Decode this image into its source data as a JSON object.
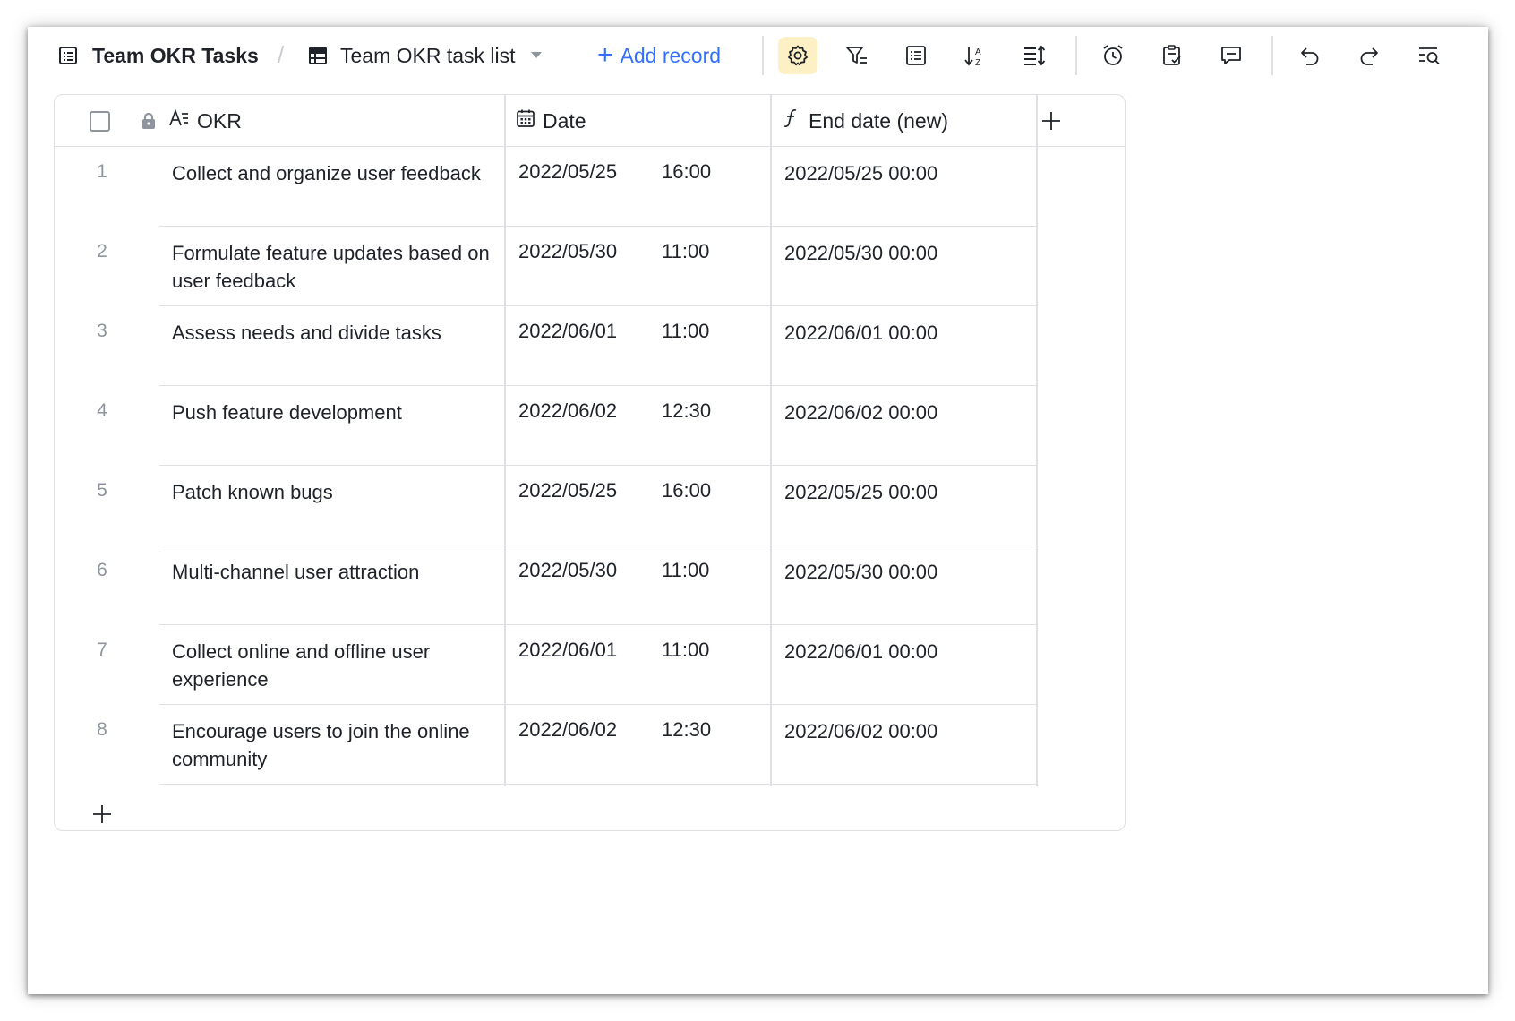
{
  "toolbar": {
    "base_name": "Team OKR Tasks",
    "separator": "/",
    "table_name": "Team OKR task list",
    "add_record_label": "Add record",
    "add_record_plus": "+",
    "icons": [
      "settings-icon",
      "filter-icon",
      "group-icon",
      "sort-icon",
      "row-height-icon",
      "reminder-icon",
      "task-check-icon",
      "comment-icon",
      "undo-icon",
      "redo-icon",
      "search-icon"
    ],
    "accent_color": "#3370ff",
    "active_icon_bg": "#fdf0c4"
  },
  "grid": {
    "columns": [
      {
        "key": "okr",
        "label": "OKR",
        "icon": "text-field-icon"
      },
      {
        "key": "date",
        "label": "Date",
        "icon": "calendar-icon"
      },
      {
        "key": "end_date",
        "label": "End date (new)",
        "icon": "formula-icon"
      }
    ],
    "rows": [
      {
        "num": "1",
        "okr": "Collect and organize user feedback",
        "date": "2022/05/25",
        "time": "16:00",
        "end_date": "2022/05/25 00:00"
      },
      {
        "num": "2",
        "okr": "Formulate feature updates based on user feedback",
        "date": "2022/05/30",
        "time": "11:00",
        "end_date": "2022/05/30 00:00"
      },
      {
        "num": "3",
        "okr": "Assess needs and divide tasks",
        "date": "2022/06/01",
        "time": "11:00",
        "end_date": "2022/06/01 00:00"
      },
      {
        "num": "4",
        "okr": "Push feature development",
        "date": "2022/06/02",
        "time": "12:30",
        "end_date": "2022/06/02 00:00"
      },
      {
        "num": "5",
        "okr": "Patch known bugs",
        "date": "2022/05/25",
        "time": "16:00",
        "end_date": "2022/05/25 00:00"
      },
      {
        "num": "6",
        "okr": "Multi-channel user attraction",
        "date": "2022/05/30",
        "time": "11:00",
        "end_date": "2022/05/30 00:00"
      },
      {
        "num": "7",
        "okr": "Collect online and offline user experience",
        "date": "2022/06/01",
        "time": "11:00",
        "end_date": "2022/06/01 00:00"
      },
      {
        "num": "8",
        "okr": "Encourage users to join the online community",
        "date": "2022/06/02",
        "time": "12:30",
        "end_date": "2022/06/02 00:00"
      }
    ]
  }
}
